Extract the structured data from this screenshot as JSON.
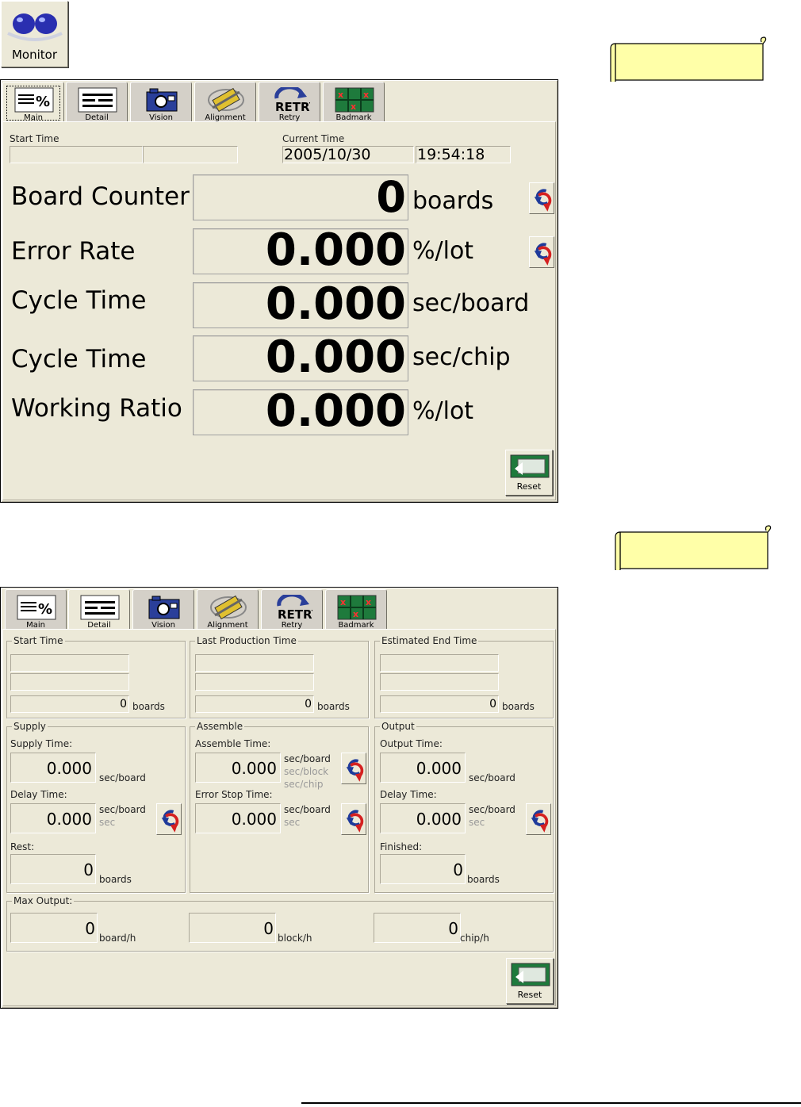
{
  "monitor_button": {
    "label": "Monitor",
    "icon": "eyes-icon"
  },
  "tabs": [
    {
      "label": "Main",
      "icon": "percent-icon"
    },
    {
      "label": "Detail",
      "icon": "detail-grid-icon"
    },
    {
      "label": "Vision",
      "icon": "camera-icon"
    },
    {
      "label": "Alignment",
      "icon": "alignment-icon"
    },
    {
      "label": "Retry",
      "icon": "retry-icon"
    },
    {
      "label": "Badmark",
      "icon": "badmark-icon"
    }
  ],
  "main_panel": {
    "start_time_label": "Start Time",
    "current_time_label": "Current Time",
    "current_date": "2005/10/30",
    "current_clock": "19:54:18",
    "rows": [
      {
        "label": "Board Counter",
        "value": "0",
        "unit": "boards"
      },
      {
        "label": "Error Rate",
        "value": "0.000",
        "unit": "%/lot"
      },
      {
        "label": "Cycle Time",
        "value": "0.000",
        "unit": "sec/board"
      },
      {
        "label": "Cycle Time",
        "value": "0.000",
        "unit": "sec/chip"
      },
      {
        "label": "Working Ratio",
        "value": "0.000",
        "unit": "%/lot"
      }
    ],
    "reset_label": "Reset"
  },
  "detail_panel": {
    "groups": {
      "start_time": {
        "title": "Start Time",
        "count": "0",
        "unit": "boards"
      },
      "last_production_time": {
        "title": "Last Production Time",
        "count": "0",
        "unit": "boards"
      },
      "estimated_end_time": {
        "title": "Estimated End Time",
        "count": "0",
        "unit": "boards"
      }
    },
    "supply": {
      "title": "Supply",
      "time_label": "Supply Time:",
      "time_value": "0.000",
      "time_unit": "sec/board",
      "delay_label": "Delay Time:",
      "delay_value": "0.000",
      "delay_unit": "sec/board",
      "delay_unit_alt": "sec",
      "rest_label": "Rest:",
      "rest_value": "0",
      "rest_unit": "boards"
    },
    "assemble": {
      "title": "Assemble",
      "time_label": "Assemble Time:",
      "time_value": "0.000",
      "time_unit": "sec/board",
      "time_unit_alt1": "sec/block",
      "time_unit_alt2": "sec/chip",
      "error_label": "Error Stop Time:",
      "error_value": "0.000",
      "error_unit": "sec/board",
      "error_unit_alt": "sec"
    },
    "output": {
      "title": "Output",
      "time_label": "Output Time:",
      "time_value": "0.000",
      "time_unit": "sec/board",
      "delay_label": "Delay Time:",
      "delay_value": "0.000",
      "delay_unit": "sec/board",
      "delay_unit_alt": "sec",
      "finished_label": "Finished:",
      "finished_value": "0",
      "finished_unit": "boards"
    },
    "max_output": {
      "title": "Max Output:",
      "items": [
        {
          "value": "0",
          "unit": "board/h"
        },
        {
          "value": "0",
          "unit": "block/h"
        },
        {
          "value": "0",
          "unit": "chip/h"
        }
      ]
    },
    "reset_label": "Reset"
  },
  "colors": {
    "panel_bg": "#ece9d8",
    "scroll_fill": "#ffffa8",
    "reset_icon": "#1e7a3c"
  }
}
